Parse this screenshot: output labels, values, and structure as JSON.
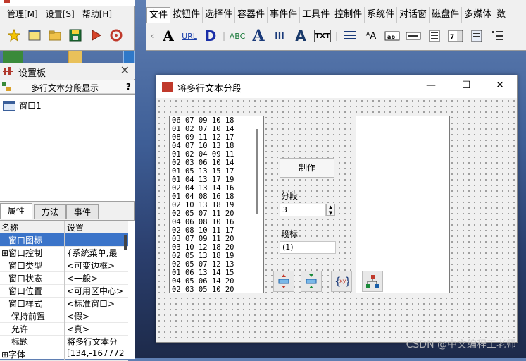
{
  "main_menu": {
    "items": [
      "管理[M]",
      "设置[S]",
      "帮助[H]"
    ]
  },
  "toolbox": {
    "tabs": [
      "文件",
      "按钮件",
      "选择件",
      "容器件",
      "事件件",
      "工具件",
      "控制件",
      "系统件",
      "对话窗",
      "磁盘件",
      "多媒体",
      "数"
    ],
    "tool_labels": [
      "A",
      "URL",
      "D",
      "ABC",
      "A",
      "III",
      "A",
      "TXT"
    ]
  },
  "settings_panel": {
    "title": "设置板",
    "subtitle": "多行文本分段显示",
    "help": "?",
    "tree": [
      {
        "label": "窗口1"
      }
    ],
    "tabs": [
      "属性",
      "方法",
      "事件"
    ],
    "grid_headers": {
      "name": "名称",
      "value": "设置"
    },
    "properties": [
      {
        "name": "窗口图标",
        "value": ""
      },
      {
        "name": "⊞窗口控制",
        "value": "{系统菜单,最"
      },
      {
        "name": "窗口类型",
        "value": "<可变边框>"
      },
      {
        "name": "窗口状态",
        "value": "<一般>"
      },
      {
        "name": "窗口位置",
        "value": "<可用区中心>"
      },
      {
        "name": "窗口样式",
        "value": "<标准窗口>"
      },
      {
        "name": "保持前置",
        "value": "<假>"
      },
      {
        "name": "允许",
        "value": "<真>"
      },
      {
        "name": "标题",
        "value": "将多行文本分"
      },
      {
        "name": "⊞字体",
        "value": "[134,-167772"
      }
    ]
  },
  "form": {
    "title": "将多行文本分段",
    "controls": {
      "make_button": "制作",
      "segment_label": "分段",
      "segment_value": "3",
      "marker_label": "段标",
      "marker_value": "(1)"
    },
    "list_lines": [
      "06 07 09 10 18",
      "01 02 07 10 14",
      "08 09 11 12 17",
      "04 07 10 13 18",
      "01 02 04 09 11",
      "02 03 06 10 14",
      "01 05 13 15 17",
      "01 04 13 17 19",
      "02 04 13 14 16",
      "01 04 08 16 18",
      "02 10 13 18 19",
      "02 05 07 11 20",
      "04 06 08 10 16",
      "02 08 10 11 17",
      "03 07 09 11 20",
      "03 10 12 18 20",
      "02 05 13 18 19",
      "02 05 07 12 13",
      "01 06 13 14 15",
      "04 05 06 14 20",
      "02 03 05 10 20"
    ]
  },
  "watermark": "CSDN @中文编程工老师"
}
